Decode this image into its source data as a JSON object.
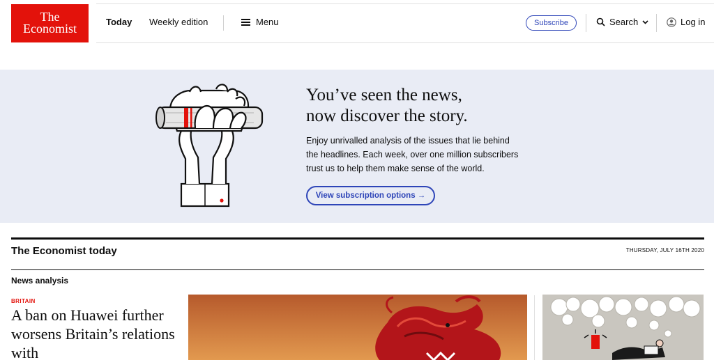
{
  "header": {
    "logo_line1": "The",
    "logo_line2": "Economist",
    "nav_today": "Today",
    "nav_weekly": "Weekly edition",
    "nav_menu": "Menu",
    "subscribe": "Subscribe",
    "search": "Search",
    "login": "Log in"
  },
  "promo": {
    "headline_line1": "You’ve seen the news,",
    "headline_line2": "now discover the story.",
    "body": "Enjoy unrivalled analysis of the issues that lie behind the headlines. Each week, over one million subscribers trust us to help them make sense of the world.",
    "button": "View subscription options →"
  },
  "section": {
    "title": "The Economist today",
    "date": "THURSDAY, JULY 16TH 2020",
    "subsection": "News analysis"
  },
  "article": {
    "flytitle": "BRITAIN",
    "headline": "A ban on Huawei further worsens Britain’s relations with"
  },
  "colors": {
    "brand_red": "#e3120b",
    "link_blue": "#2e45b8",
    "promo_bg": "#e9ecf5"
  }
}
